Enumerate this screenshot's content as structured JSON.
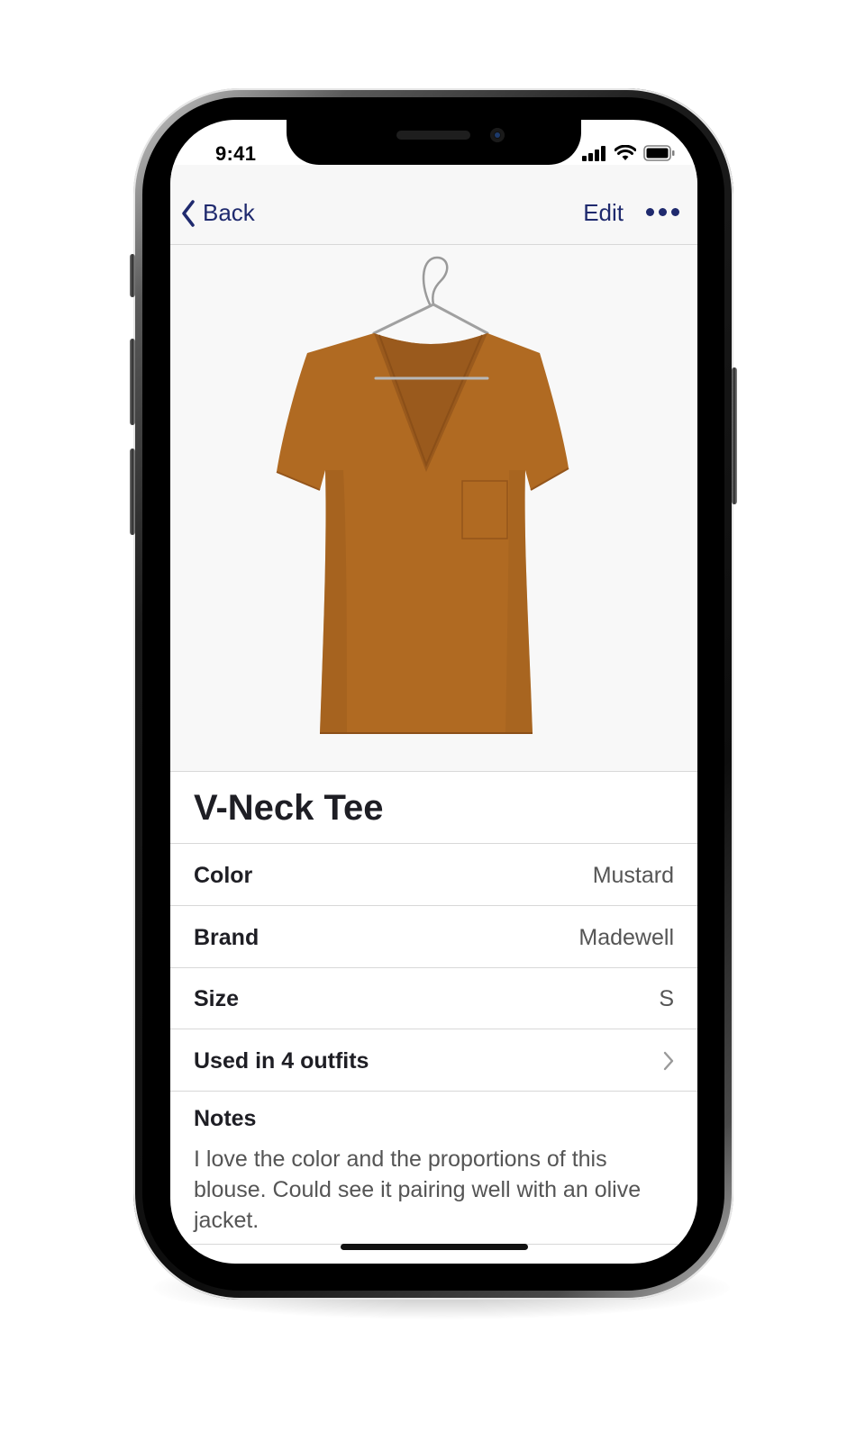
{
  "status_bar": {
    "time": "9:41"
  },
  "nav": {
    "back_label": "Back",
    "edit_label": "Edit"
  },
  "item": {
    "title": "V-Neck Tee",
    "color_swatch": "#b06a22"
  },
  "details": [
    {
      "label": "Color",
      "value": "Mustard"
    },
    {
      "label": "Brand",
      "value": "Madewell"
    },
    {
      "label": "Size",
      "value": "S"
    }
  ],
  "outfits_row": {
    "label": "Used in 4 outfits"
  },
  "notes": {
    "label": "Notes",
    "text": "I love the color and the proportions of this blouse. Could see it pairing well with an olive jacket."
  },
  "colors": {
    "accent": "#1f2a6e",
    "separator": "#d8d8d8"
  }
}
